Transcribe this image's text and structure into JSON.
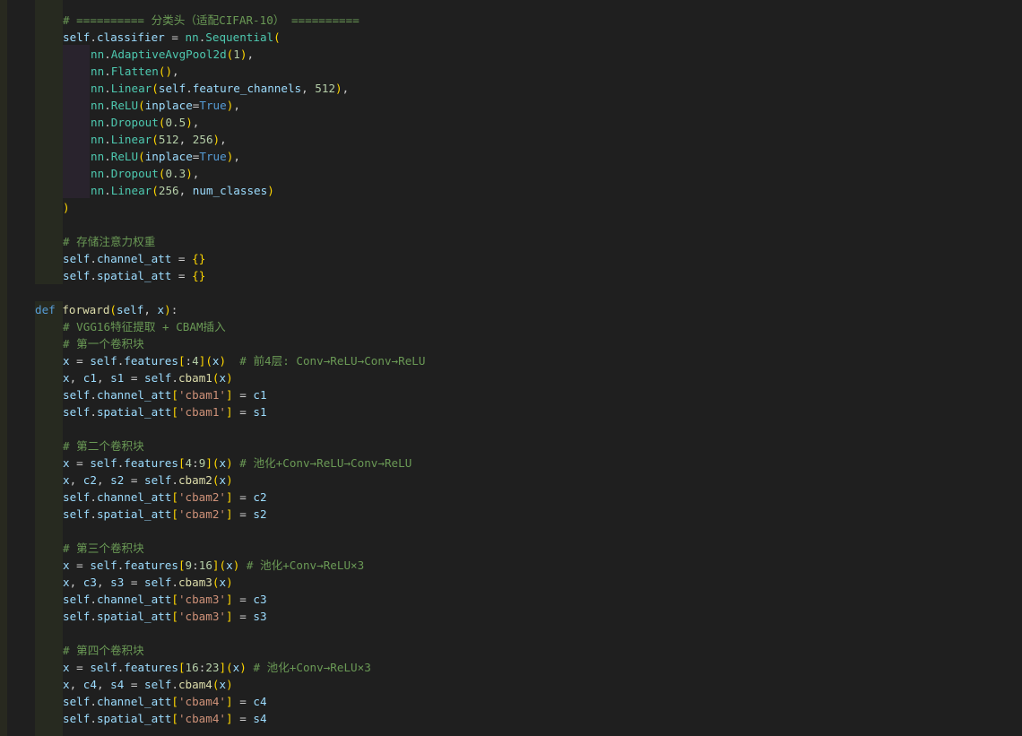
{
  "editor": {
    "language": "python",
    "theme_colors": {
      "background": "#1f1f1f",
      "comment": "#6a9955",
      "keyword": "#569cd6",
      "function": "#dcdcaa",
      "class": "#4ec9b0",
      "number": "#b5cea8",
      "string": "#ce9178",
      "variable": "#9cdcfe",
      "bracket_level1": "#ffd700",
      "bracket_level2": "#da70d6"
    },
    "lines": [
      "# ========== 分类头（适配CIFAR-10） ==========",
      "self.classifier = nn.Sequential(",
      "nn.AdaptiveAvgPool2d(1),",
      "nn.Flatten(),",
      "nn.Linear(self.feature_channels, 512),",
      "nn.ReLU(inplace=True),",
      "nn.Dropout(0.5),",
      "nn.Linear(512, 256),",
      "nn.ReLU(inplace=True),",
      "nn.Dropout(0.3),",
      "nn.Linear(256, num_classes)",
      ")",
      "",
      "# 存储注意力权重",
      "self.channel_att = {}",
      "self.spatial_att = {}",
      "",
      "def forward(self, x):",
      "# VGG16特征提取 + CBAM插入",
      "# 第一个卷积块",
      "x = self.features[:4](x)  # 前4层: Conv→ReLU→Conv→ReLU",
      "x, c1, s1 = self.cbam1(x)",
      "self.channel_att['cbam1'] = c1",
      "self.spatial_att['cbam1'] = s1",
      "",
      "# 第二个卷积块",
      "x = self.features[4:9](x) # 池化+Conv→ReLU→Conv→ReLU",
      "x, c2, s2 = self.cbam2(x)",
      "self.channel_att['cbam2'] = c2",
      "self.spatial_att['cbam2'] = s2",
      "",
      "# 第三个卷积块",
      "x = self.features[9:16](x) # 池化+Conv→ReLU×3",
      "x, c3, s3 = self.cbam3(x)",
      "self.channel_att['cbam3'] = c3",
      "self.spatial_att['cbam3'] = s3",
      "",
      "# 第四个卷积块",
      "x = self.features[16:23](x) # 池化+Conv→ReLU×3",
      "x, c4, s4 = self.cbam4(x)",
      "self.channel_att['cbam4'] = c4",
      "self.spatial_att['cbam4'] = s4"
    ]
  }
}
